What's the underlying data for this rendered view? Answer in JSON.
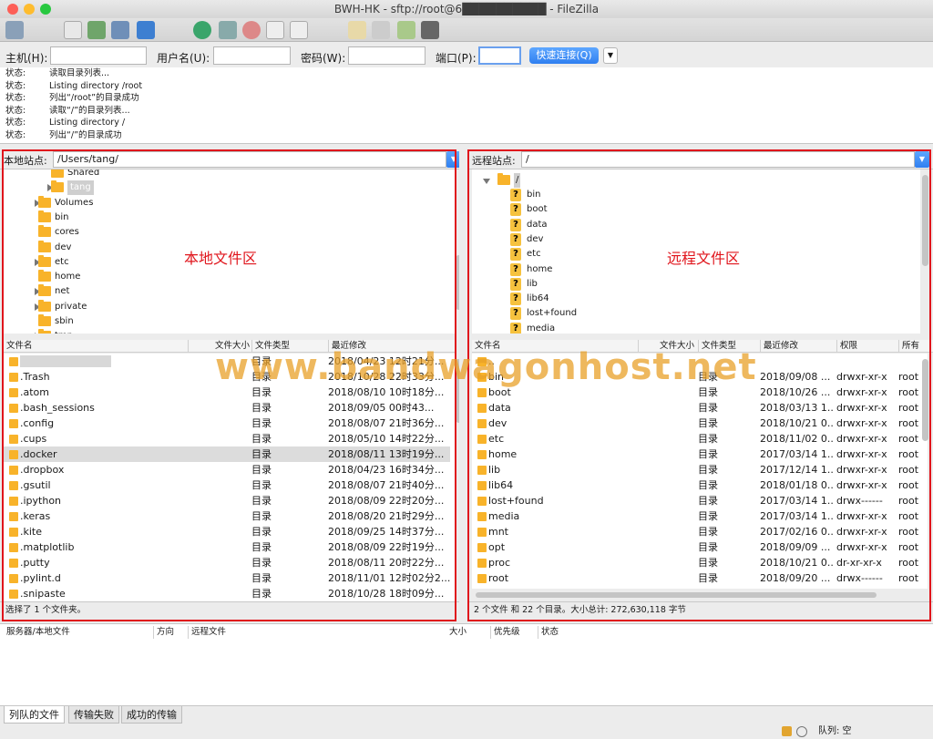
{
  "window": {
    "title": "BWH-HK - sftp://root@6██████████ - FileZilla"
  },
  "quickconnect": {
    "host_label": "主机(H):",
    "user_label": "用户名(U):",
    "pass_label": "密码(W):",
    "port_label": "端口(P):",
    "connect_label": "快速连接(Q)",
    "host_value": "",
    "user_value": "",
    "pass_value": "",
    "port_value": ""
  },
  "log": [
    {
      "k": "状态:",
      "v": "读取目录列表..."
    },
    {
      "k": "状态:",
      "v": "Listing directory /root"
    },
    {
      "k": "状态:",
      "v": "列出“/root”的目录成功"
    },
    {
      "k": "状态:",
      "v": "读取“/”的目录列表..."
    },
    {
      "k": "状态:",
      "v": "Listing directory /"
    },
    {
      "k": "状态:",
      "v": "列出“/”的目录成功"
    }
  ],
  "local": {
    "site_label": "本地站点:",
    "path": "/Users/tang/",
    "area_label": "本地文件区",
    "tree": [
      {
        "name": "Shared",
        "indent": 2,
        "arrow": false
      },
      {
        "name": "tang",
        "indent": 2,
        "arrow": true
      },
      {
        "name": "Volumes",
        "indent": 1,
        "arrow": true
      },
      {
        "name": "bin",
        "indent": 1,
        "arrow": false
      },
      {
        "name": "cores",
        "indent": 1,
        "arrow": false
      },
      {
        "name": "dev",
        "indent": 1,
        "arrow": false
      },
      {
        "name": "etc",
        "indent": 1,
        "arrow": true
      },
      {
        "name": "home",
        "indent": 1,
        "arrow": false
      },
      {
        "name": "net",
        "indent": 1,
        "arrow": true
      },
      {
        "name": "private",
        "indent": 1,
        "arrow": true
      },
      {
        "name": "sbin",
        "indent": 1,
        "arrow": false
      },
      {
        "name": "tmp",
        "indent": 1,
        "arrow": true
      }
    ],
    "headers": {
      "name": "文件名",
      "size": "文件大小",
      "type": "文件类型",
      "modified": "最近修改"
    },
    "files": [
      {
        "name": "",
        "type": "目录",
        "modified": "2018/04/23 12时21分..."
      },
      {
        "name": ".Trash",
        "type": "目录",
        "modified": "2018/10/28 22时33分..."
      },
      {
        "name": ".atom",
        "type": "目录",
        "modified": "2018/08/10 10时18分..."
      },
      {
        "name": ".bash_sessions",
        "type": "目录",
        "modified": "2018/09/05 00时43..."
      },
      {
        "name": ".config",
        "type": "目录",
        "modified": "2018/08/07 21时36分..."
      },
      {
        "name": ".cups",
        "type": "目录",
        "modified": "2018/05/10 14时22分..."
      },
      {
        "name": ".docker",
        "type": "目录",
        "modified": "2018/08/11 13时19分..."
      },
      {
        "name": ".dropbox",
        "type": "目录",
        "modified": "2018/04/23 16时34分..."
      },
      {
        "name": ".gsutil",
        "type": "目录",
        "modified": "2018/08/07 21时40分..."
      },
      {
        "name": ".ipython",
        "type": "目录",
        "modified": "2018/08/09 22时20分..."
      },
      {
        "name": ".keras",
        "type": "目录",
        "modified": "2018/08/20 21时29分..."
      },
      {
        "name": ".kite",
        "type": "目录",
        "modified": "2018/09/25 14时37分..."
      },
      {
        "name": ".matplotlib",
        "type": "目录",
        "modified": "2018/08/09 22时19分..."
      },
      {
        "name": ".putty",
        "type": "目录",
        "modified": "2018/08/11 20时22分..."
      },
      {
        "name": ".pylint.d",
        "type": "目录",
        "modified": "2018/11/01 12时02分2..."
      },
      {
        "name": ".snipaste",
        "type": "目录",
        "modified": "2018/10/28 18时09分..."
      }
    ],
    "status": "选择了 1 个文件夹。"
  },
  "remote": {
    "site_label": "远程站点:",
    "path": "/",
    "area_label": "远程文件区",
    "tree_root": "/",
    "tree": [
      "bin",
      "boot",
      "data",
      "dev",
      "etc",
      "home",
      "lib",
      "lib64",
      "lost+found",
      "media"
    ],
    "headers": {
      "name": "文件名",
      "size": "文件大小",
      "type": "文件类型",
      "modified": "最近修改",
      "perms": "权限",
      "owner": "所有"
    },
    "files": [
      {
        "name": "..",
        "type": "",
        "modified": "",
        "perms": "",
        "owner": ""
      },
      {
        "name": "bin",
        "type": "目录",
        "modified": "2018/09/08 ...",
        "perms": "drwxr-xr-x",
        "owner": "root"
      },
      {
        "name": "boot",
        "type": "目录",
        "modified": "2018/10/26 ...",
        "perms": "drwxr-xr-x",
        "owner": "root"
      },
      {
        "name": "data",
        "type": "目录",
        "modified": "2018/03/13 1...",
        "perms": "drwxr-xr-x",
        "owner": "root"
      },
      {
        "name": "dev",
        "type": "目录",
        "modified": "2018/10/21 0...",
        "perms": "drwxr-xr-x",
        "owner": "root"
      },
      {
        "name": "etc",
        "type": "目录",
        "modified": "2018/11/02 0...",
        "perms": "drwxr-xr-x",
        "owner": "root"
      },
      {
        "name": "home",
        "type": "目录",
        "modified": "2017/03/14 1...",
        "perms": "drwxr-xr-x",
        "owner": "root"
      },
      {
        "name": "lib",
        "type": "目录",
        "modified": "2017/12/14 1...",
        "perms": "drwxr-xr-x",
        "owner": "root"
      },
      {
        "name": "lib64",
        "type": "目录",
        "modified": "2018/01/18 0...",
        "perms": "drwxr-xr-x",
        "owner": "root"
      },
      {
        "name": "lost+found",
        "type": "目录",
        "modified": "2017/03/14 1...",
        "perms": "drwx------",
        "owner": "root"
      },
      {
        "name": "media",
        "type": "目录",
        "modified": "2017/03/14 1...",
        "perms": "drwxr-xr-x",
        "owner": "root"
      },
      {
        "name": "mnt",
        "type": "目录",
        "modified": "2017/02/16 0...",
        "perms": "drwxr-xr-x",
        "owner": "root"
      },
      {
        "name": "opt",
        "type": "目录",
        "modified": "2018/09/09 ...",
        "perms": "drwxr-xr-x",
        "owner": "root"
      },
      {
        "name": "proc",
        "type": "目录",
        "modified": "2018/10/21 0...",
        "perms": "dr-xr-xr-x",
        "owner": "root"
      },
      {
        "name": "root",
        "type": "目录",
        "modified": "2018/09/20 ...",
        "perms": "drwx------",
        "owner": "root"
      }
    ],
    "status": "2 个文件 和 22 个目录。大小总计: 272,630,118 字节"
  },
  "queue": {
    "h_server": "服务器/本地文件",
    "h_dir": "方向",
    "h_remote": "远程文件",
    "h_size": "大小",
    "h_prio": "优先级",
    "h_status": "状态"
  },
  "tabs": [
    "列队的文件",
    "传输失败",
    "成功的传输"
  ],
  "bottom": {
    "queue": "队列: 空"
  },
  "watermark": "www.bandwagonhost.net"
}
